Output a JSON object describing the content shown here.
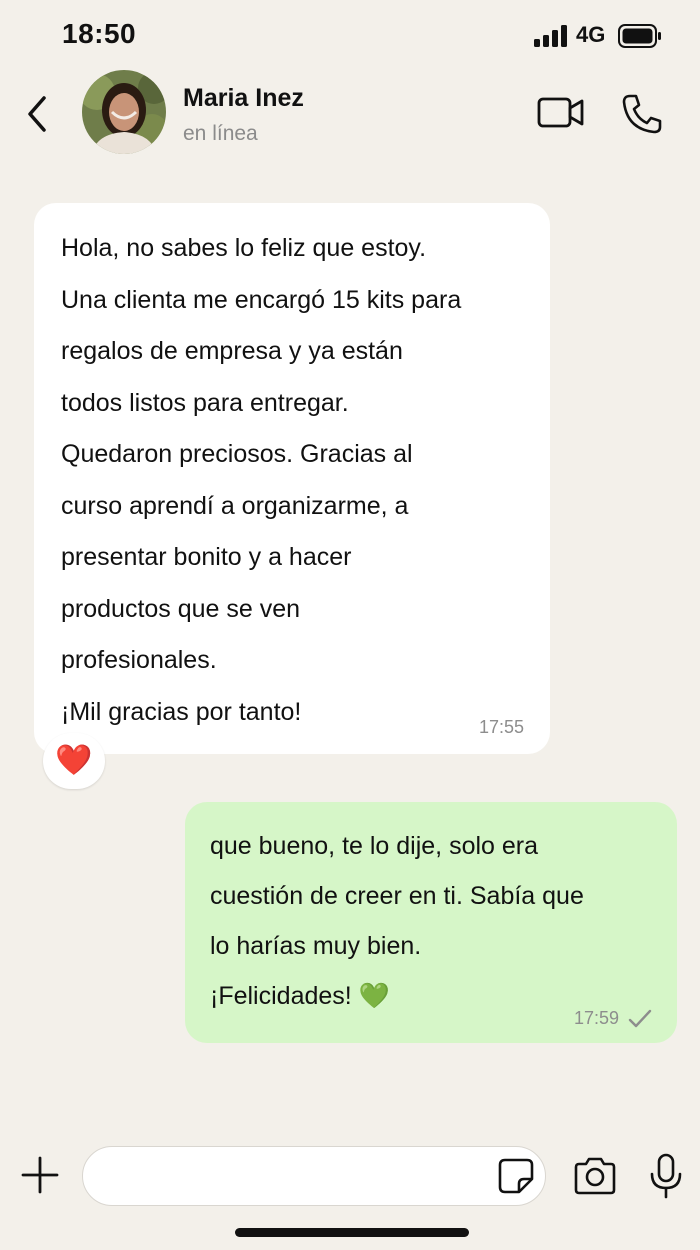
{
  "status_bar": {
    "time": "18:50",
    "network": "4G",
    "icons": [
      "signal-bars-icon",
      "battery-icon"
    ]
  },
  "header": {
    "contact_name": "Maria Inez",
    "presence": "en línea",
    "icons": [
      "back-chevron-icon",
      "avatar",
      "video-call-icon",
      "phone-call-icon"
    ]
  },
  "messages": [
    {
      "direction": "incoming",
      "text": "Hola, no sabes lo feliz que estoy.\nUna clienta me encargó 15 kits para\nregalos de empresa y ya están\ntodos listos para entregar.\nQuedaron preciosos. Gracias al\ncurso aprendí a organizarme, a\npresentar bonito y a hacer\nproductos que se ven\nprofesionales.\n¡Mil gracias por tanto!",
      "time": "17:55",
      "reaction": "❤️"
    },
    {
      "direction": "outgoing",
      "text": "que bueno, te lo dije, solo era\ncuestión de creer en ti. Sabía que\nlo harías muy bien.\n¡Felicidades! 💚",
      "time": "17:59",
      "status_icon": "single-check-icon"
    }
  ],
  "composer": {
    "value": "",
    "icons": [
      "plus-icon",
      "sticker-icon",
      "camera-icon",
      "microphone-icon"
    ]
  },
  "colors": {
    "background": "#f3f0ea",
    "incoming_bubble": "#ffffff",
    "outgoing_bubble": "#d6f6c8",
    "heart": "#e11d2a",
    "green_heart": "#2fbf3a"
  }
}
